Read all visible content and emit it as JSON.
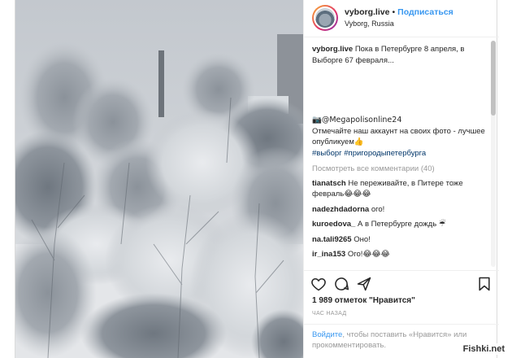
{
  "header": {
    "username": "vyborg.live",
    "separator": "•",
    "follow_label": "Подписаться",
    "location": "Vyborg, Russia"
  },
  "caption": {
    "username": "vyborg.live",
    "text": "Пока в Петербурге 8 апреля, в Выборге 67 февраля...",
    "mention_line": "📷@Megapolisonline24",
    "body": "Отмечайте наш аккаунт на своих фото - лучшее опубликуем👍",
    "hashtags": "#выборг #пригородыпетербурга"
  },
  "view_all_comments": "Посмотреть все комментарии (40)",
  "comments": [
    {
      "user": "tianatsch",
      "text": "Не переживайте, в Питере тоже февраль😂😂😂"
    },
    {
      "user": "nadezhdadorna",
      "text": "ого!"
    },
    {
      "user": "kuroedova_",
      "text": "А в Петербурге дождь ☔"
    },
    {
      "user": "na.tali9265",
      "text": "Оно!"
    },
    {
      "user": "ir_ina153",
      "text": "Ого!😂😂😂"
    }
  ],
  "actions": {
    "like_icon": "heart-icon",
    "comment_icon": "comment-icon",
    "share_icon": "share-icon",
    "save_icon": "bookmark-icon"
  },
  "likes_text": "1 989 отметок \"Нравится\"",
  "time_text": "ЧАС НАЗАД",
  "login": {
    "link": "Войдите",
    "text": ", чтобы поставить «Нравится» или прокомментировать."
  },
  "watermark": "Fishki.net",
  "colors": {
    "link_blue": "#3897f0",
    "hashtag": "#003569",
    "muted": "#999999",
    "text": "#262626"
  }
}
